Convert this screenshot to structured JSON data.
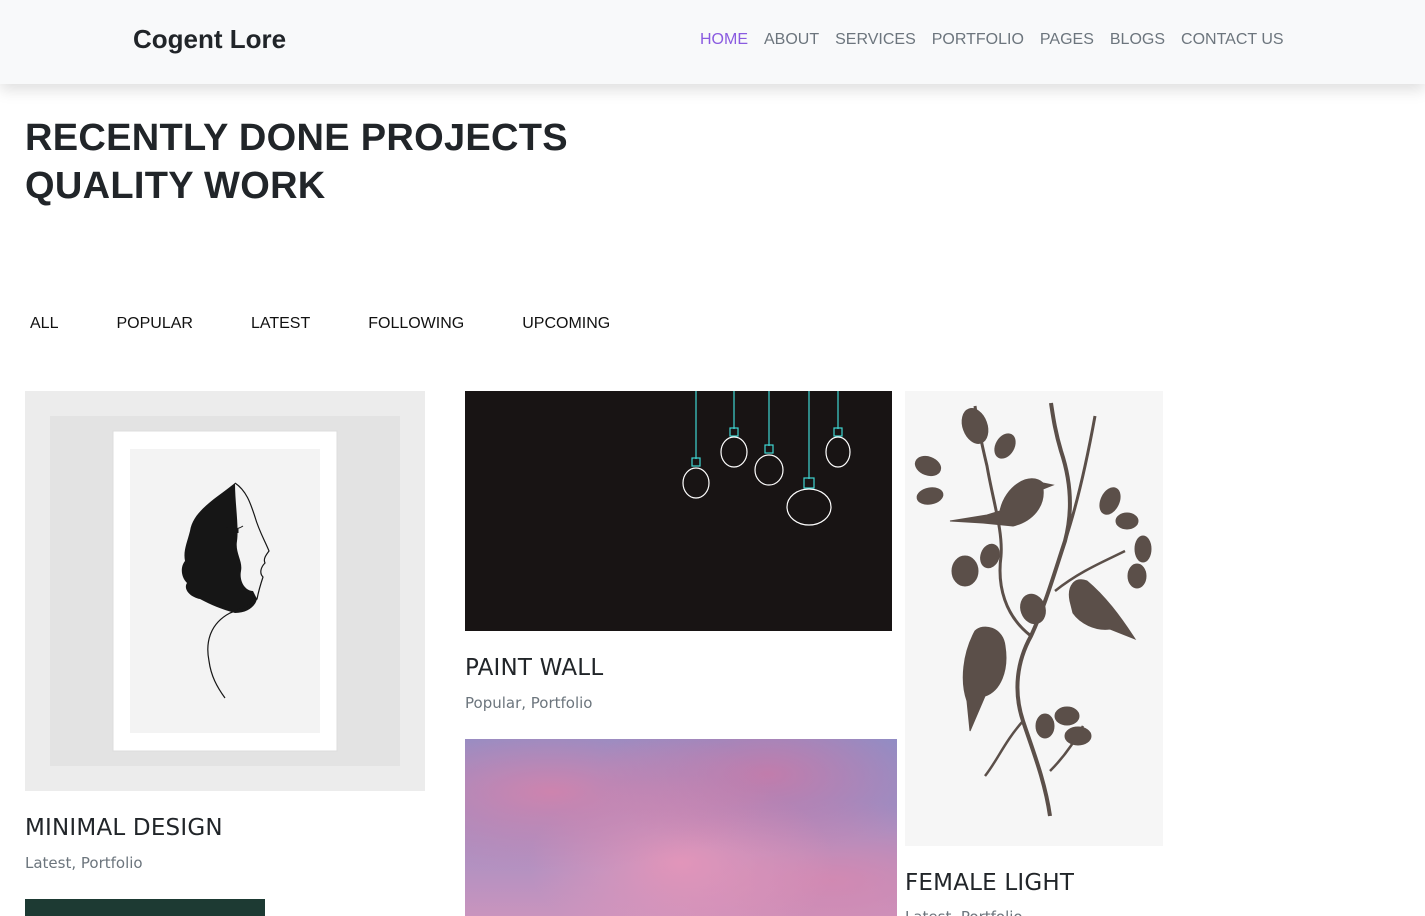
{
  "brand": {
    "name": "Cogent Lore"
  },
  "nav": {
    "items": [
      {
        "label": "HOME",
        "active": true
      },
      {
        "label": "ABOUT"
      },
      {
        "label": "SERVICES"
      },
      {
        "label": "PORTFOLIO"
      },
      {
        "label": "PAGES"
      },
      {
        "label": "BLOGS"
      },
      {
        "label": "CONTACT US"
      }
    ]
  },
  "hero": {
    "line1": "RECENTLY DONE PROJECTS",
    "line2": "QUALITY WORK"
  },
  "filters": [
    "ALL",
    "POPULAR",
    "LATEST",
    "FOLLOWING",
    "UPCOMING"
  ],
  "projects": {
    "minimal": {
      "title": "MINIMAL DESIGN",
      "tags": "Latest, Portfolio"
    },
    "paint": {
      "title": "PAINT WALL",
      "tags": "Popular, Portfolio"
    },
    "female": {
      "title": "FEMALE LIGHT",
      "tags": "Latest, Portfolio"
    }
  },
  "colors": {
    "accent": "#8a5be0",
    "nav_text": "#6c757d",
    "bulb": "#3fd6d3",
    "bird": "#5b4f49"
  }
}
